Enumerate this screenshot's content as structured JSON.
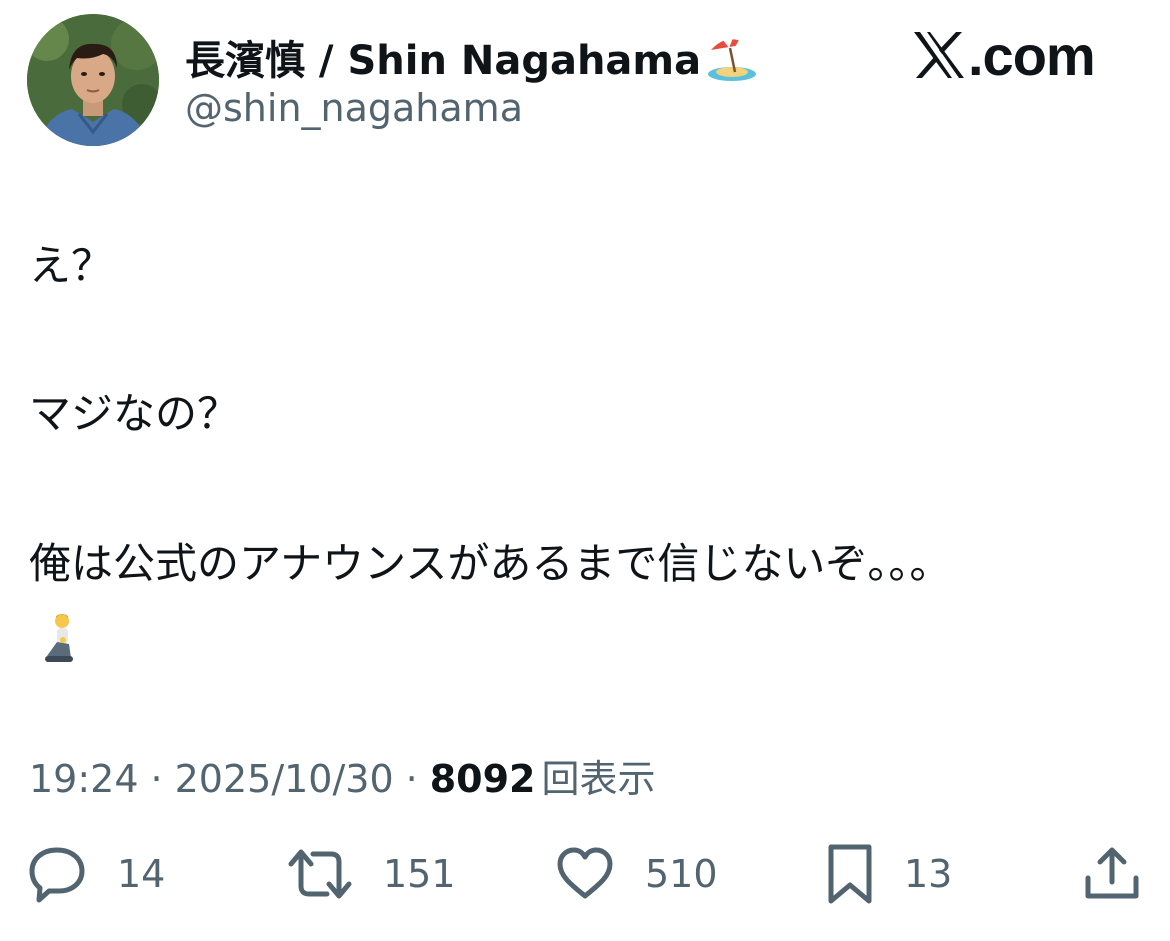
{
  "author": {
    "display_name": "長濱慎 / Shin Nagahama",
    "name_emoji": "beach-with-umbrella-emoji",
    "handle": "@shin_nagahama",
    "avatar": "profile-photo"
  },
  "brand": {
    "logo_text": ".com",
    "logo_icon": "x-logo-icon"
  },
  "tweet": {
    "line1": "え？",
    "line2": "マジなの？",
    "line3": "俺は公式のアナウンスがあるまで信じないぞ。。。",
    "trailing_emoji": "person-kneeling-emoji"
  },
  "meta": {
    "time": "19:24",
    "separator": "·",
    "date": "2025/10/30",
    "views_count": "8092",
    "views_label": "回表示"
  },
  "actions": {
    "reply": {
      "icon": "reply-icon",
      "count": "14"
    },
    "retweet": {
      "icon": "retweet-icon",
      "count": "151"
    },
    "like": {
      "icon": "heart-icon",
      "count": "510"
    },
    "bookmark": {
      "icon": "bookmark-icon",
      "count": "13"
    },
    "share": {
      "icon": "share-icon"
    }
  },
  "colors": {
    "text_primary": "#0f1419",
    "text_secondary": "#536471"
  }
}
